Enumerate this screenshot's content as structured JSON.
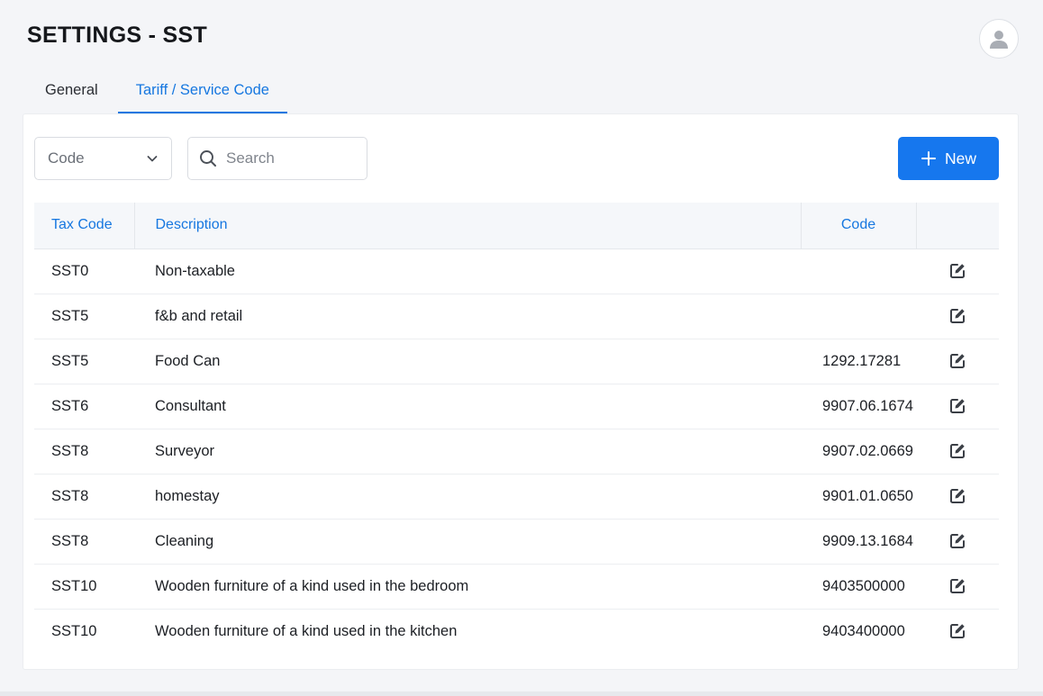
{
  "header": {
    "title": "SETTINGS - SST",
    "avatar_icon": "user-icon"
  },
  "tabs": [
    {
      "label": "General",
      "active": false
    },
    {
      "label": "Tariff / Service Code",
      "active": true
    }
  ],
  "toolbar": {
    "filter_select": {
      "value": "Code",
      "icon": "chevron-down-icon"
    },
    "search": {
      "placeholder": "Search",
      "value": "",
      "icon": "search-icon"
    },
    "new_button": {
      "label": "New",
      "icon": "plus-icon"
    }
  },
  "table": {
    "columns": [
      "Tax Code",
      "Description",
      "Code",
      ""
    ],
    "rows": [
      {
        "tax_code": "SST0",
        "description": "Non-taxable",
        "code": ""
      },
      {
        "tax_code": "SST5",
        "description": "f&b and retail",
        "code": ""
      },
      {
        "tax_code": "SST5",
        "description": "Food Can",
        "code": "1292.17281"
      },
      {
        "tax_code": "SST6",
        "description": "Consultant",
        "code": "9907.06.1674"
      },
      {
        "tax_code": "SST8",
        "description": "Surveyor",
        "code": "9907.02.0669"
      },
      {
        "tax_code": "SST8",
        "description": "homestay",
        "code": "9901.01.0650"
      },
      {
        "tax_code": "SST8",
        "description": "Cleaning",
        "code": "9909.13.1684"
      },
      {
        "tax_code": "SST10",
        "description": "Wooden furniture of a kind used in the bedroom",
        "code": "9403500000"
      },
      {
        "tax_code": "SST10",
        "description": "Wooden furniture of a kind used in the kitchen",
        "code": "9403400000"
      }
    ],
    "row_action_icon": "edit-icon"
  },
  "colors": {
    "accent": "#1677e0",
    "button": "#1677ee",
    "header_bg": "#f5f7fa"
  }
}
